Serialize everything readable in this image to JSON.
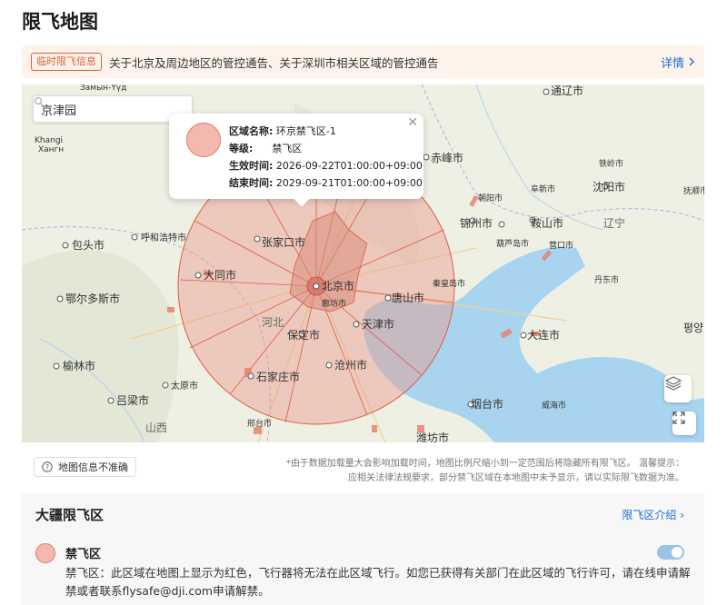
{
  "page": {
    "title": "限飞地图"
  },
  "notice": {
    "badge": "临时限飞信息",
    "text": "关于北京及周边地区的管控通告、关于深圳市相关区域的管控通告",
    "link": "详情"
  },
  "map": {
    "search": {
      "value": "京津园"
    },
    "popup": {
      "name_key": "区域名称:",
      "name_val": "环京禁飞区-1",
      "level_key": "等级:",
      "level_val": "禁飞区",
      "start_key": "生效时间:",
      "start_val": "2026-09-22T01:00:00+09:00",
      "end_key": "结束时间:",
      "end_val": "2029-09-21T01:00:00+09:00"
    },
    "labels": {
      "zamyn": "Замын-Үүд",
      "khangi1": "Khangi",
      "khangi2": "Хангн",
      "baotou": "包头市",
      "hohhot": "呼和浩特市",
      "zhangjiakou": "张家口市",
      "datong": "大同市",
      "ordos": "鄂尔多斯市",
      "yulin": "榆林市",
      "lvliang": "吕梁市",
      "taiyuan": "太原市",
      "shanxi": "山西",
      "xingtai": "邢台市",
      "beijing": "北京市",
      "langfang": "廊坊市",
      "tangshan": "唐山市",
      "tianjin": "天津市",
      "hebei": "河北",
      "baoding": "保定市",
      "shijiazhuang": "石家庄市",
      "cangzhou": "沧州市",
      "chifeng": "赤峰市",
      "chaoyang": "朝阳市",
      "jinzhou": "锦州市",
      "anshan": "鞍山市",
      "huludao": "葫芦岛市",
      "yingkou": "营口市",
      "qinhuangdao": "秦皇岛市",
      "tongliao": "通辽市",
      "tieling": "铁岭市",
      "fuxin": "阜新市",
      "shenyang": "沈阳市",
      "fushun": "抚顺市",
      "liaoning": "辽宁",
      "dandong": "丹东市",
      "dalian": "大连市",
      "pyongyang": "평양",
      "yantai": "烟台市",
      "weihai": "威海市",
      "weifang": "潍坊市"
    }
  },
  "below": {
    "inaccurate": "地图信息不准确",
    "disclaimer_line1": "*由于数据加载量大会影响加载时间，地图比例尺缩小到一定范围后将隐藏所有限飞区。 温馨提示：",
    "disclaimer_line2": "应相关法律法规要求，部分禁飞区域在本地图中未予显示，请以实际限飞数据为准。"
  },
  "section": {
    "title": "大疆限飞区",
    "link": "限飞区介绍",
    "zone_name": "禁飞区",
    "zone_desc": "禁飞区：此区域在地图上显示为红色，飞行器将无法在此区域飞行。如您已获得有关部门在此区域的飞行许可，请在线申请解禁或者联系flysafe@dji.com申请解禁。"
  },
  "colors": {
    "accent": "#1a6fd8",
    "no_fly_fill": "#f4b9ae",
    "no_fly_stroke": "#e07a66",
    "notice_bg": "#fdf3ea"
  }
}
